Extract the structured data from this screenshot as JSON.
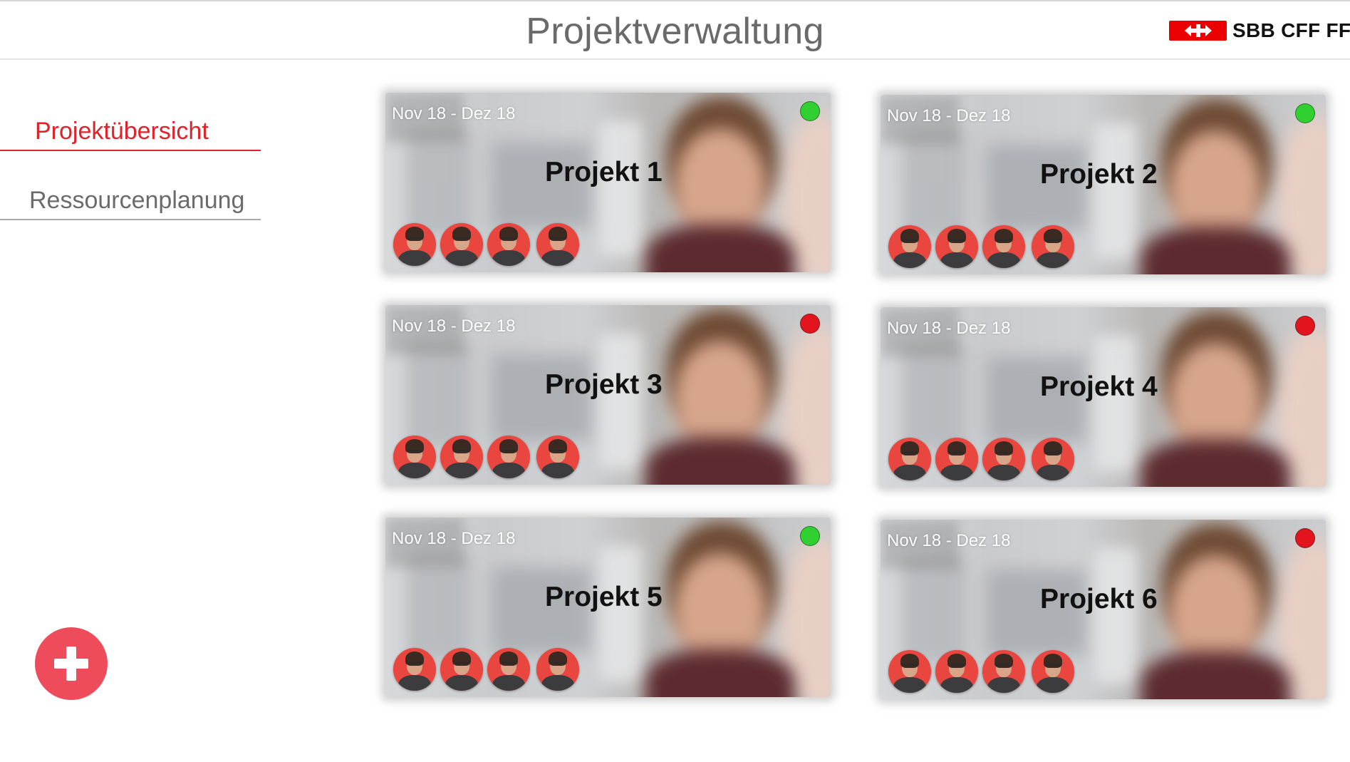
{
  "header": {
    "title": "Projektverwaltung",
    "logo_text": "SBB CFF FFS",
    "logo_icon": "sbb-arrows-icon",
    "brand_color": "#eb0000"
  },
  "sidebar": {
    "items": [
      {
        "label": "Projektübersicht",
        "active": true
      },
      {
        "label": "Ressourcenplanung",
        "active": false
      }
    ],
    "accent_color": "#e2212b"
  },
  "add_button": {
    "icon": "plus-icon",
    "color": "#ee4c5b"
  },
  "projects": [
    {
      "name": "Projekt 1",
      "dates": "Nov 18 - Dez 18",
      "status": "green",
      "members": 4
    },
    {
      "name": "Projekt 2",
      "dates": "Nov 18 - Dez 18",
      "status": "green",
      "members": 4
    },
    {
      "name": "Projekt 3",
      "dates": "Nov 18 - Dez 18",
      "status": "red",
      "members": 4
    },
    {
      "name": "Projekt 4",
      "dates": "Nov 18 - Dez 18",
      "status": "red",
      "members": 4
    },
    {
      "name": "Projekt 5",
      "dates": "Nov 18 - Dez 18",
      "status": "green",
      "members": 4
    },
    {
      "name": "Projekt 6",
      "dates": "Nov 18 - Dez 18",
      "status": "red",
      "members": 4
    }
  ],
  "status_colors": {
    "green": "#2fd02f",
    "red": "#e3141e"
  }
}
